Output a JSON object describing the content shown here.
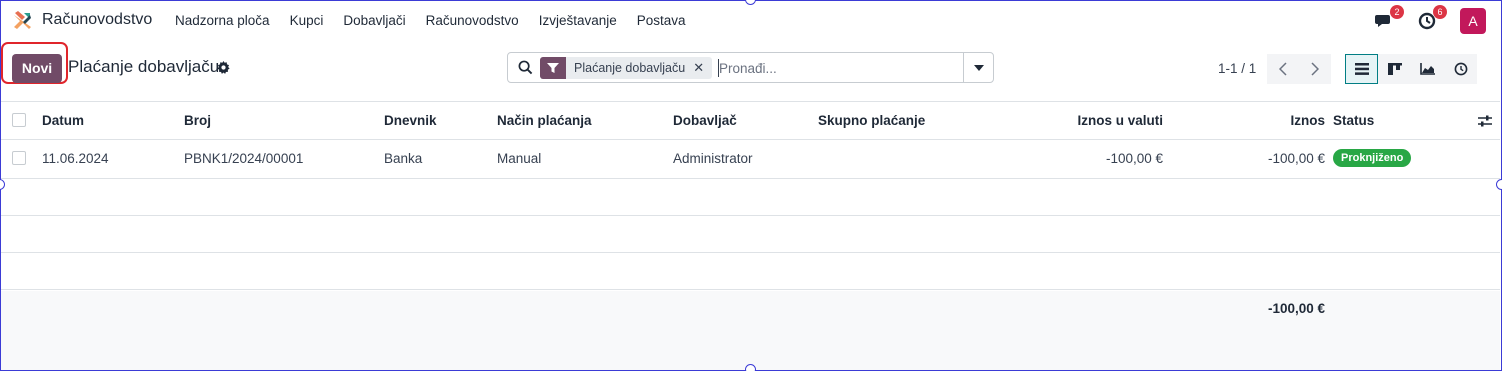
{
  "app": {
    "name": "Računovodstvo",
    "logo_icon": "accounting-app-logo-icon",
    "menu": [
      "Nadzorna ploča",
      "Kupci",
      "Dobavljači",
      "Računovodstvo",
      "Izvještavanje",
      "Postava"
    ]
  },
  "systray": {
    "messages_badge": "2",
    "activities_badge": "6",
    "avatar_initial": "A",
    "avatar_color": "#c2185b"
  },
  "control_panel": {
    "new_button": "Novi",
    "title": "Plaćanje dobavljaču",
    "search": {
      "facet": "Plaćanje dobavljaču",
      "facet_close": "✕",
      "placeholder": "Pronađi..."
    },
    "pager": "1-1 / 1",
    "views": [
      "list-view-icon",
      "kanban-view-icon",
      "graph-view-icon",
      "activity-view-icon"
    ],
    "active_view": "list"
  },
  "table": {
    "columns": {
      "datum": "Datum",
      "broj": "Broj",
      "dnevnik": "Dnevnik",
      "nacin": "Način plaćanja",
      "dobavljac": "Dobavljač",
      "skupno": "Skupno plaćanje",
      "iznos_valuta": "Iznos u valuti",
      "iznos": "Iznos",
      "status": "Status"
    },
    "rows": [
      {
        "datum": "11.06.2024",
        "broj": "PBNK1/2024/00001",
        "dnevnik": "Banka",
        "nacin": "Manual",
        "dobavljac": "Administrator",
        "skupno": "",
        "iznos_valuta": "-100,00 €",
        "iznos": "-100,00 €",
        "status": "Proknjiženo"
      }
    ],
    "total_iznos": "-100,00 €"
  },
  "colors": {
    "brand": "#714b67",
    "status_posted": "#28a745",
    "highlight_border": "#e0252b"
  }
}
